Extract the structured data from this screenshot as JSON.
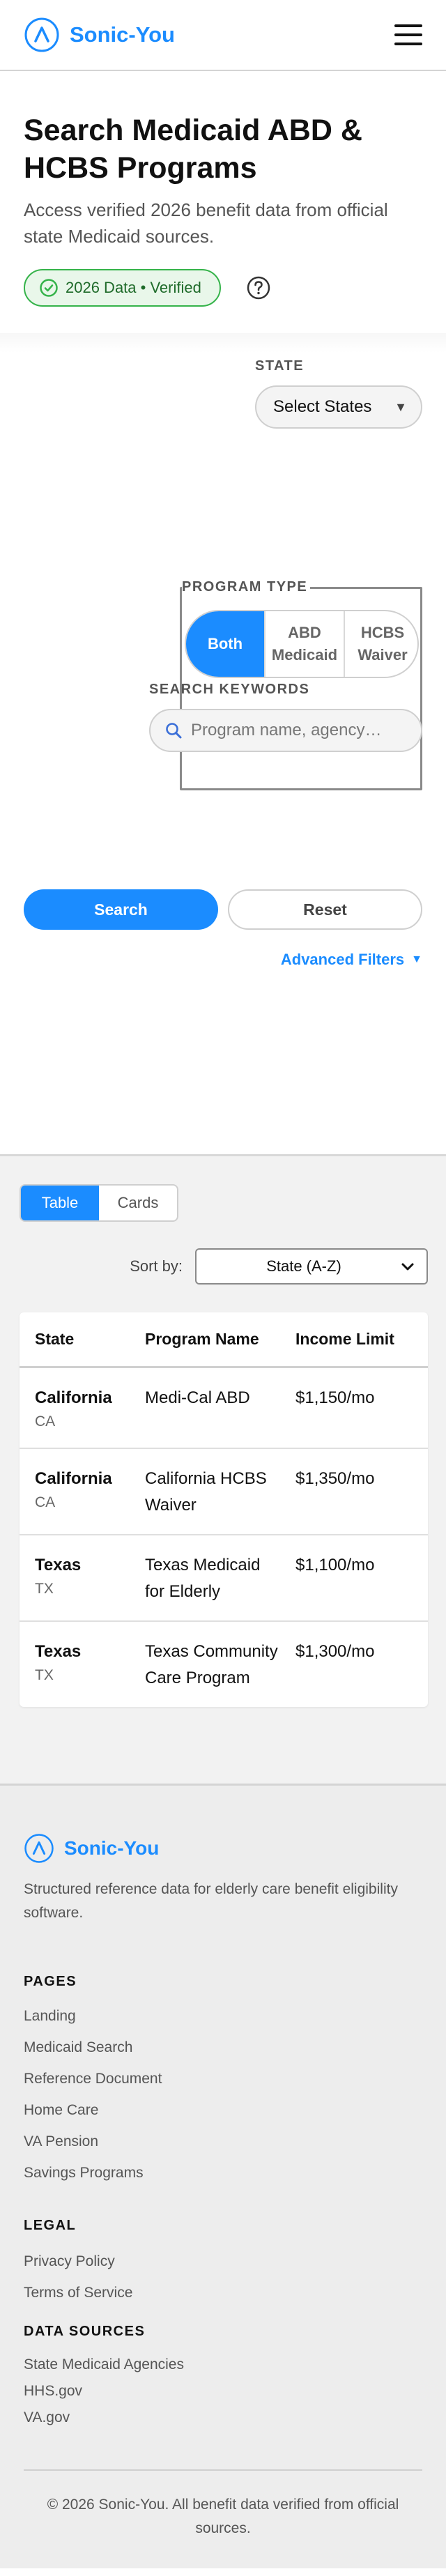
{
  "header": {
    "brand": "Sonic-You",
    "brand_color": "#1b8cff",
    "logo_icon": "sonic-you-logo",
    "menu_icon": "hamburger-menu"
  },
  "hero": {
    "title": "Search Medicaid ABD & HCBS Programs",
    "subtitle": "Access verified 2026 benefit data from official state Medicaid sources.",
    "badge": "2026 Data • Verified",
    "badge_icon": "check-circle",
    "help_icon": "question-circle"
  },
  "filters": {
    "state_label": "STATE",
    "state_value": "Select States",
    "program_type_label": "PROGRAM TYPE",
    "program_types": [
      "Both",
      "ABD\nMedicaid",
      "HCBS\nWaiver"
    ],
    "program_type_selected": "Both",
    "keywords_label": "SEARCH KEYWORDS",
    "keywords_placeholder": "Program name, agency…",
    "search_button": "Search",
    "reset_button": "Reset",
    "advanced_filters": "Advanced Filters"
  },
  "results": {
    "views": [
      "Table",
      "Cards"
    ],
    "view_selected": "Table",
    "sort_label": "Sort by:",
    "sort_value": "State (A-Z)",
    "columns": [
      "State",
      "Program Name",
      "Income Limit"
    ],
    "rows": [
      {
        "state": "California",
        "abbr": "CA",
        "program": "Medi-Cal ABD",
        "income": "$1,150/mo"
      },
      {
        "state": "California",
        "abbr": "CA",
        "program": "California HCBS Waiver",
        "income": "$1,350/mo"
      },
      {
        "state": "Texas",
        "abbr": "TX",
        "program": "Texas Medicaid for Elderly",
        "income": "$1,100/mo"
      },
      {
        "state": "Texas",
        "abbr": "TX",
        "program": "Texas Community Care Program",
        "income": "$1,300/mo"
      }
    ]
  },
  "footer": {
    "brand": "Sonic-You",
    "description": "Structured reference data for elderly care benefit eligibility software.",
    "pages_heading": "PAGES",
    "pages": [
      "Landing",
      "Medicaid Search",
      "Reference Document",
      "Home Care",
      "VA Pension",
      "Savings Programs"
    ],
    "legal_heading": "LEGAL",
    "legal": [
      "Privacy Policy",
      "Terms of Service"
    ],
    "sources_heading": "DATA SOURCES",
    "sources": [
      "State Medicaid Agencies",
      "HHS.gov",
      "VA.gov"
    ],
    "copyright": "© 2026 Sonic-You. All benefit data verified from official sources."
  }
}
